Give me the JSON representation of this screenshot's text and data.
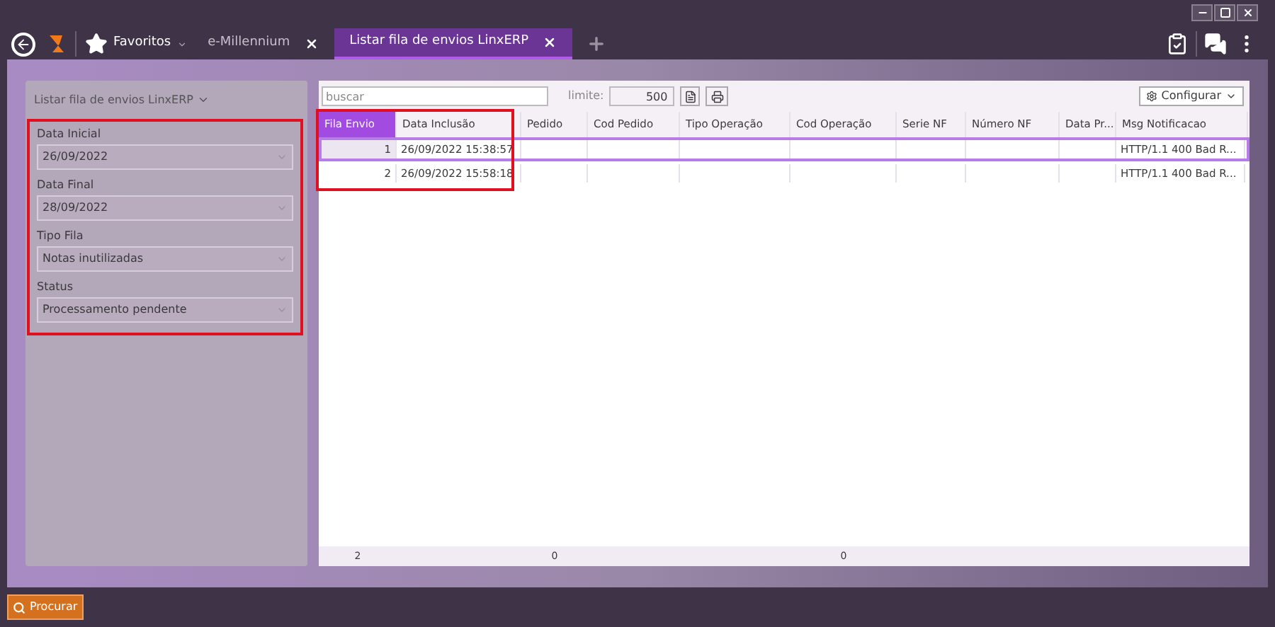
{
  "tabs": [
    {
      "label": "Favoritos",
      "kind": "menu",
      "selected": false
    },
    {
      "label": "e-Millennium",
      "kind": "tab",
      "selected": false
    },
    {
      "label": "Listar fila de envios LinxERP",
      "kind": "tab",
      "selected": true
    }
  ],
  "filter_panel": {
    "title": "Listar fila de envios LinxERP",
    "highlighted": true,
    "fields": [
      {
        "label": "Data Inicial",
        "value": "26/09/2022"
      },
      {
        "label": "Data Final",
        "value": "28/09/2022"
      },
      {
        "label": "Tipo Fila",
        "value": "Notas inutilizadas"
      },
      {
        "label": "Status",
        "value": "Processamento pendente"
      }
    ]
  },
  "toolbar": {
    "search_placeholder": "buscar",
    "limit_label": "limite:",
    "limit_value": "500",
    "configure_label": "Configurar"
  },
  "table": {
    "highlighted": true,
    "columns": [
      {
        "label": "Fila Envio",
        "sorted": true
      },
      {
        "label": "Data Inclusão",
        "sorted": false
      },
      {
        "label": "Pedido",
        "sorted": false
      },
      {
        "label": "Cod Pedido",
        "sorted": false
      },
      {
        "label": "Tipo Operação",
        "sorted": false
      },
      {
        "label": "Cod Operação",
        "sorted": false
      },
      {
        "label": "Serie NF",
        "sorted": false
      },
      {
        "label": "Número NF",
        "sorted": false
      },
      {
        "label": "Data Pr...",
        "sorted": false
      },
      {
        "label": "Msg Notificacao",
        "sorted": false
      }
    ],
    "rows": [
      {
        "selected": true,
        "fila_envio": "1",
        "data_inclusao": "26/09/2022 15:38:57",
        "msg_notificacao": "HTTP/1.1 400 Bad R..."
      },
      {
        "selected": false,
        "fila_envio": "2",
        "data_inclusao": "26/09/2022 15:58:18",
        "msg_notificacao": "HTTP/1.1 400 Bad R..."
      }
    ],
    "totals": [
      "2",
      "0",
      "0"
    ]
  },
  "search_button": "Procurar"
}
